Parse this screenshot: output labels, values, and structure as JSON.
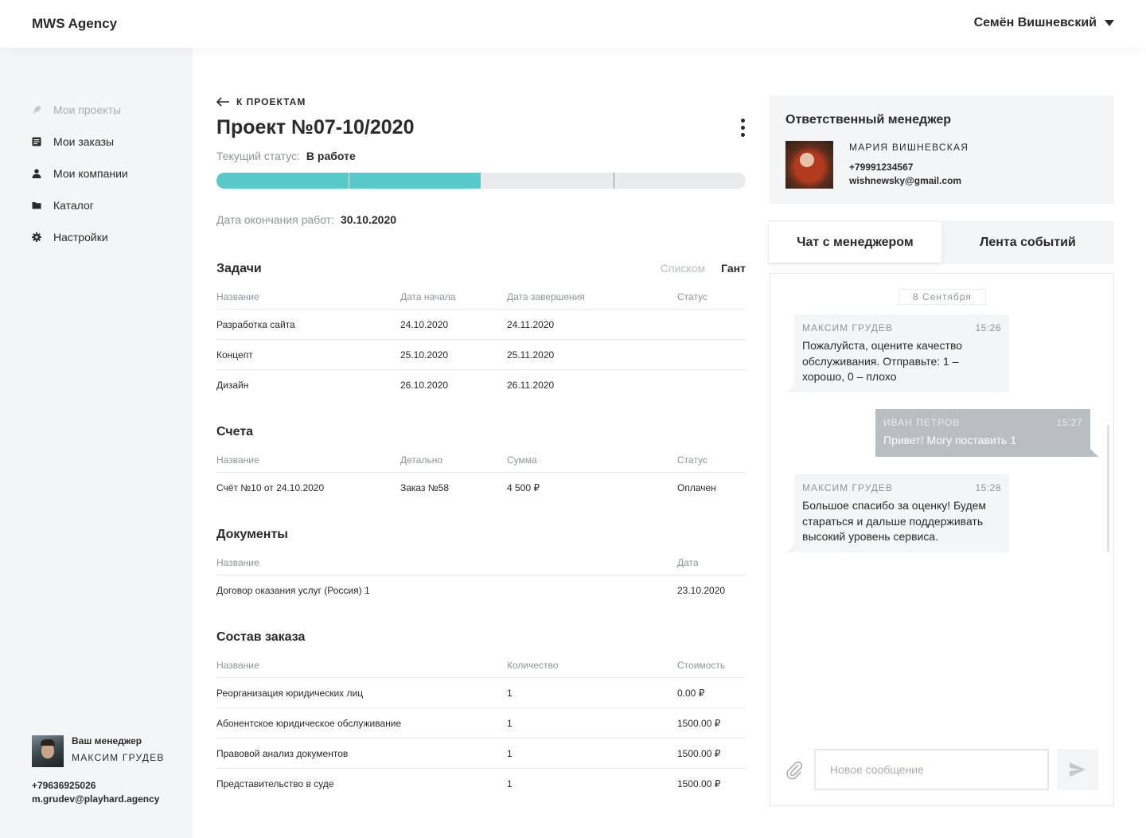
{
  "header": {
    "brand": "MWS Agency",
    "user_name": "Семён Вишневский"
  },
  "sidebar": {
    "items": [
      {
        "label": "Мои проекты",
        "icon": "rocket-icon",
        "disabled": true
      },
      {
        "label": "Мои заказы",
        "icon": "document-icon"
      },
      {
        "label": "Мои компании",
        "icon": "user-icon"
      },
      {
        "label": "Каталог",
        "icon": "folder-icon"
      },
      {
        "label": "Настройки",
        "icon": "gear-icon"
      }
    ],
    "manager": {
      "title": "Ваш менеджер",
      "name": "МАКСИМ ГРУДЕВ",
      "phone": "+79636925026",
      "email": "m.grudev@playhard.agency"
    }
  },
  "project": {
    "back_label": "К ПРОЕКТАМ",
    "title": "Проект №07-10/2020",
    "status_label": "Текущий статус:",
    "status_value": "В работе",
    "progress": {
      "completed_stages": 2,
      "total_stages": 4
    },
    "end_label": "Дата окончания работ:",
    "end_value": "30.10.2020"
  },
  "tasks": {
    "title": "Задачи",
    "view_list": "Списком",
    "view_gantt": "Гант",
    "headers": [
      "Название",
      "Дата начала",
      "Дата завершения",
      "Статус"
    ],
    "rows": [
      [
        "Разработка сайта",
        "24.10.2020",
        "24.11.2020",
        ""
      ],
      [
        "Концепт",
        "25.10.2020",
        "25.11.2020",
        ""
      ],
      [
        "Дизайн",
        "26.10.2020",
        "26.11.2020",
        ""
      ]
    ]
  },
  "invoices": {
    "title": "Счета",
    "headers": [
      "Название",
      "Детально",
      "Сумма",
      "Статус"
    ],
    "rows": [
      [
        "Счёт №10 от 24.10.2020",
        "Заказ №58",
        "4 500 ₽",
        "Оплачен"
      ]
    ]
  },
  "documents": {
    "title": "Документы",
    "headers": [
      "Название",
      "Дата"
    ],
    "rows": [
      [
        "Договор оказания услуг (Россия) 1",
        "23.10.2020"
      ]
    ]
  },
  "order": {
    "title": "Состав заказа",
    "headers": [
      "Название",
      "Количество",
      "Стоимость"
    ],
    "rows": [
      [
        "Реорганизация юридических лиц",
        "1",
        "0.00 ₽"
      ],
      [
        "Абонентское юридическое обслуживание",
        "1",
        "1500.00 ₽"
      ],
      [
        "Правовой анализ документов",
        "1",
        "1500.00 ₽"
      ],
      [
        "Представительство в суде",
        "1",
        "1500.00 ₽"
      ]
    ]
  },
  "responsible": {
    "title": "Ответственный менеджер",
    "name": "МАРИЯ ВИШНЕВСКАЯ",
    "phone": "+79991234567",
    "email": "wishnewsky@gmail.com"
  },
  "tabs": {
    "chat": "Чат с менеджером",
    "events": "Лента событий"
  },
  "chat": {
    "date": "8 Сентября",
    "messages": [
      {
        "author": "МАКСИМ ГРУДЕВ",
        "time": "15:26",
        "text": "Пожалуйста, оцените качество обслуживания. Отправьте: 1 – хорошо, 0 – плохо"
      },
      {
        "author": "ИВАН ПЕТРОВ",
        "time": "15:27",
        "text": "Привет! Могу поставить 1"
      },
      {
        "author": "МАКСИМ ГРУДЕВ",
        "time": "15:28",
        "text": "Большое спасибо за оценку! Будем стараться и дальше поддерживать высокий уровень сервиса."
      }
    ],
    "input_placeholder": "Новое сообщение"
  },
  "colors": {
    "accent": "#59c8c8",
    "sidebar_bg": "#f4f5f6",
    "muted": "#8f959b",
    "outgoing_bubble": "#b9bec2"
  }
}
